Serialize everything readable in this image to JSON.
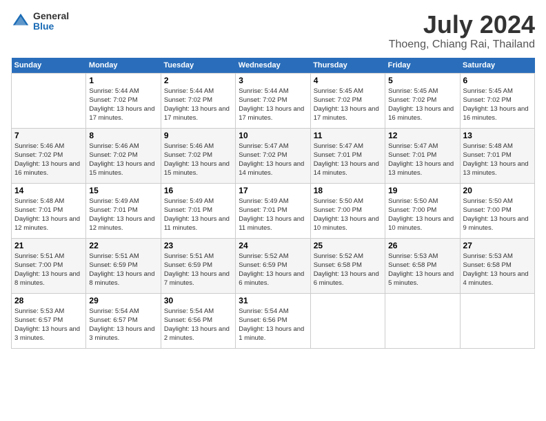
{
  "header": {
    "logo_general": "General",
    "logo_blue": "Blue",
    "month_title": "July 2024",
    "location": "Thoeng, Chiang Rai, Thailand"
  },
  "days": [
    "Sunday",
    "Monday",
    "Tuesday",
    "Wednesday",
    "Thursday",
    "Friday",
    "Saturday"
  ],
  "weeks": [
    [
      {
        "date": "",
        "sunrise": "",
        "sunset": "",
        "daylight": ""
      },
      {
        "date": "1",
        "sunrise": "Sunrise: 5:44 AM",
        "sunset": "Sunset: 7:02 PM",
        "daylight": "Daylight: 13 hours and 17 minutes."
      },
      {
        "date": "2",
        "sunrise": "Sunrise: 5:44 AM",
        "sunset": "Sunset: 7:02 PM",
        "daylight": "Daylight: 13 hours and 17 minutes."
      },
      {
        "date": "3",
        "sunrise": "Sunrise: 5:44 AM",
        "sunset": "Sunset: 7:02 PM",
        "daylight": "Daylight: 13 hours and 17 minutes."
      },
      {
        "date": "4",
        "sunrise": "Sunrise: 5:45 AM",
        "sunset": "Sunset: 7:02 PM",
        "daylight": "Daylight: 13 hours and 17 minutes."
      },
      {
        "date": "5",
        "sunrise": "Sunrise: 5:45 AM",
        "sunset": "Sunset: 7:02 PM",
        "daylight": "Daylight: 13 hours and 16 minutes."
      },
      {
        "date": "6",
        "sunrise": "Sunrise: 5:45 AM",
        "sunset": "Sunset: 7:02 PM",
        "daylight": "Daylight: 13 hours and 16 minutes."
      }
    ],
    [
      {
        "date": "7",
        "sunrise": "Sunrise: 5:46 AM",
        "sunset": "Sunset: 7:02 PM",
        "daylight": "Daylight: 13 hours and 16 minutes."
      },
      {
        "date": "8",
        "sunrise": "Sunrise: 5:46 AM",
        "sunset": "Sunset: 7:02 PM",
        "daylight": "Daylight: 13 hours and 15 minutes."
      },
      {
        "date": "9",
        "sunrise": "Sunrise: 5:46 AM",
        "sunset": "Sunset: 7:02 PM",
        "daylight": "Daylight: 13 hours and 15 minutes."
      },
      {
        "date": "10",
        "sunrise": "Sunrise: 5:47 AM",
        "sunset": "Sunset: 7:02 PM",
        "daylight": "Daylight: 13 hours and 14 minutes."
      },
      {
        "date": "11",
        "sunrise": "Sunrise: 5:47 AM",
        "sunset": "Sunset: 7:01 PM",
        "daylight": "Daylight: 13 hours and 14 minutes."
      },
      {
        "date": "12",
        "sunrise": "Sunrise: 5:47 AM",
        "sunset": "Sunset: 7:01 PM",
        "daylight": "Daylight: 13 hours and 13 minutes."
      },
      {
        "date": "13",
        "sunrise": "Sunrise: 5:48 AM",
        "sunset": "Sunset: 7:01 PM",
        "daylight": "Daylight: 13 hours and 13 minutes."
      }
    ],
    [
      {
        "date": "14",
        "sunrise": "Sunrise: 5:48 AM",
        "sunset": "Sunset: 7:01 PM",
        "daylight": "Daylight: 13 hours and 12 minutes."
      },
      {
        "date": "15",
        "sunrise": "Sunrise: 5:49 AM",
        "sunset": "Sunset: 7:01 PM",
        "daylight": "Daylight: 13 hours and 12 minutes."
      },
      {
        "date": "16",
        "sunrise": "Sunrise: 5:49 AM",
        "sunset": "Sunset: 7:01 PM",
        "daylight": "Daylight: 13 hours and 11 minutes."
      },
      {
        "date": "17",
        "sunrise": "Sunrise: 5:49 AM",
        "sunset": "Sunset: 7:01 PM",
        "daylight": "Daylight: 13 hours and 11 minutes."
      },
      {
        "date": "18",
        "sunrise": "Sunrise: 5:50 AM",
        "sunset": "Sunset: 7:00 PM",
        "daylight": "Daylight: 13 hours and 10 minutes."
      },
      {
        "date": "19",
        "sunrise": "Sunrise: 5:50 AM",
        "sunset": "Sunset: 7:00 PM",
        "daylight": "Daylight: 13 hours and 10 minutes."
      },
      {
        "date": "20",
        "sunrise": "Sunrise: 5:50 AM",
        "sunset": "Sunset: 7:00 PM",
        "daylight": "Daylight: 13 hours and 9 minutes."
      }
    ],
    [
      {
        "date": "21",
        "sunrise": "Sunrise: 5:51 AM",
        "sunset": "Sunset: 7:00 PM",
        "daylight": "Daylight: 13 hours and 8 minutes."
      },
      {
        "date": "22",
        "sunrise": "Sunrise: 5:51 AM",
        "sunset": "Sunset: 6:59 PM",
        "daylight": "Daylight: 13 hours and 8 minutes."
      },
      {
        "date": "23",
        "sunrise": "Sunrise: 5:51 AM",
        "sunset": "Sunset: 6:59 PM",
        "daylight": "Daylight: 13 hours and 7 minutes."
      },
      {
        "date": "24",
        "sunrise": "Sunrise: 5:52 AM",
        "sunset": "Sunset: 6:59 PM",
        "daylight": "Daylight: 13 hours and 6 minutes."
      },
      {
        "date": "25",
        "sunrise": "Sunrise: 5:52 AM",
        "sunset": "Sunset: 6:58 PM",
        "daylight": "Daylight: 13 hours and 6 minutes."
      },
      {
        "date": "26",
        "sunrise": "Sunrise: 5:53 AM",
        "sunset": "Sunset: 6:58 PM",
        "daylight": "Daylight: 13 hours and 5 minutes."
      },
      {
        "date": "27",
        "sunrise": "Sunrise: 5:53 AM",
        "sunset": "Sunset: 6:58 PM",
        "daylight": "Daylight: 13 hours and 4 minutes."
      }
    ],
    [
      {
        "date": "28",
        "sunrise": "Sunrise: 5:53 AM",
        "sunset": "Sunset: 6:57 PM",
        "daylight": "Daylight: 13 hours and 3 minutes."
      },
      {
        "date": "29",
        "sunrise": "Sunrise: 5:54 AM",
        "sunset": "Sunset: 6:57 PM",
        "daylight": "Daylight: 13 hours and 3 minutes."
      },
      {
        "date": "30",
        "sunrise": "Sunrise: 5:54 AM",
        "sunset": "Sunset: 6:56 PM",
        "daylight": "Daylight: 13 hours and 2 minutes."
      },
      {
        "date": "31",
        "sunrise": "Sunrise: 5:54 AM",
        "sunset": "Sunset: 6:56 PM",
        "daylight": "Daylight: 13 hours and 1 minute."
      },
      {
        "date": "",
        "sunrise": "",
        "sunset": "",
        "daylight": ""
      },
      {
        "date": "",
        "sunrise": "",
        "sunset": "",
        "daylight": ""
      },
      {
        "date": "",
        "sunrise": "",
        "sunset": "",
        "daylight": ""
      }
    ]
  ]
}
